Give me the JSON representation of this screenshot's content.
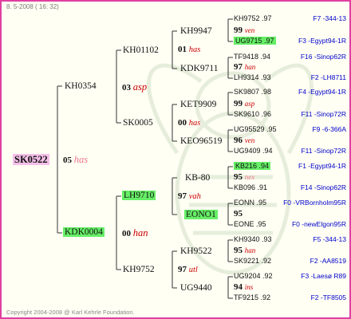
{
  "header": "8. 5-2008 ( 16: 32)",
  "footer": "Copyright 2004-2008 @ Karl Kehrle Foundation.",
  "colors": {
    "frame": "#e040a0",
    "highlight_green": "#66ee66",
    "highlight_pink": "#f4c0e8",
    "link": "#0000cc",
    "origin_red": "#cc0000"
  },
  "root": "SK0522",
  "gen1": [
    {
      "year": "05",
      "origin": "has"
    }
  ],
  "gen2": [
    {
      "id": "KH0354"
    },
    {
      "id": "KDK0004"
    }
  ],
  "gen2_marks": [
    {
      "year": "03",
      "origin": "asp"
    },
    {
      "year": "00",
      "origin": "han"
    }
  ],
  "gen3": [
    {
      "id": "KH01102"
    },
    {
      "id": "SK0005"
    },
    {
      "id": "LH9710"
    },
    {
      "id": "KH9752"
    }
  ],
  "gen3_marks": [
    {
      "year": "01",
      "origin": "has"
    },
    {
      "year": "00",
      "origin": "has"
    },
    {
      "year": "97",
      "origin": "vah"
    },
    {
      "year": "97",
      "origin": "utl"
    }
  ],
  "gen4": [
    {
      "id": "KH9947"
    },
    {
      "id": "KDK9711"
    },
    {
      "id": "KET9909"
    },
    {
      "id": "KEO96519"
    },
    {
      "id": "KB-80"
    },
    {
      "id": "EONO1"
    },
    {
      "id": "KH9522"
    },
    {
      "id": "UG9440"
    }
  ],
  "gen4_marks": [
    {
      "year": "99",
      "origin": "ven"
    },
    {
      "year": "97",
      "origin": "han"
    },
    {
      "year": "99",
      "origin": "asp"
    },
    {
      "year": "96",
      "origin": "ven"
    },
    {
      "year": "95",
      "origin": "nex"
    },
    {
      "year": "95",
      "origin": ""
    },
    {
      "year": "95",
      "origin": "han"
    },
    {
      "year": "94",
      "origin": "ins"
    }
  ],
  "gen5": [
    {
      "id": "KH9752",
      "score": ".97",
      "ref": "F7 -344-13"
    },
    {
      "id": "UG9715",
      "score": ".97",
      "ref": "F3 -Egypt94-1R"
    },
    {
      "id": "TF9418",
      "score": ".94",
      "ref": "F16 -Sinop62R"
    },
    {
      "id": "LH9314",
      "score": ".93",
      "ref": "F2 -LH8711"
    },
    {
      "id": "SK9807",
      "score": ".98",
      "ref": "F4 -Egypt94-1R"
    },
    {
      "id": "SK9610",
      "score": ".96",
      "ref": "F11 -Sinop72R"
    },
    {
      "id": "UG95529",
      "score": ".95",
      "ref": "F9 -6-366A"
    },
    {
      "id": "UG9409",
      "score": ".94",
      "ref": "F11 -Sinop72R"
    },
    {
      "id": "KB216",
      "score": ".94",
      "ref": "F1 -Egypt94-1R"
    },
    {
      "id": "KB096",
      "score": ".91",
      "ref": "F14 -Sinop62R"
    },
    {
      "id": "EONN",
      "score": ".95",
      "ref": "F0 -VRBornholm95R"
    },
    {
      "id": "EONE",
      "score": ".95",
      "ref": "F0 -newElgon95R"
    },
    {
      "id": "KH9340",
      "score": ".93",
      "ref": "F5 -344-13"
    },
    {
      "id": "SK9221",
      "score": ".92",
      "ref": "F2 -AA8519"
    },
    {
      "id": "UG9204",
      "score": ".92",
      "ref": "F3 -Laesø R89"
    },
    {
      "id": "TF9215",
      "score": ".92",
      "ref": "F2 -TF8505"
    }
  ]
}
